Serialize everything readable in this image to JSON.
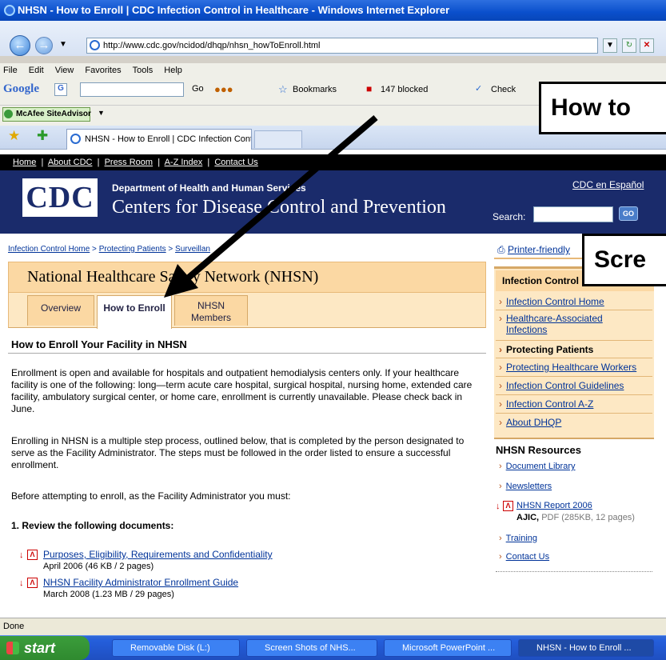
{
  "window": {
    "title": "NHSN - How to Enroll | CDC Infection Control in Healthcare - Windows Internet Explorer"
  },
  "browser": {
    "url": "http://www.cdc.gov/ncidod/dhqp/nhsn_howToEnroll.html",
    "menu": [
      "File",
      "Edit",
      "View",
      "Favorites",
      "Tools",
      "Help"
    ],
    "google_toolbar": {
      "logo": "Google",
      "go": "Go",
      "bookmarks": "Bookmarks",
      "blocked": "147 blocked",
      "check": "Check"
    },
    "mcafee": "McAfee SiteAdvisor",
    "tab_title": "NHSN - How to Enroll | CDC Infection Control in Healt..."
  },
  "site": {
    "topnav": [
      "Home",
      "About CDC",
      "Press Room",
      "A-Z Index",
      "Contact Us"
    ],
    "logo": "CDC",
    "department": "Department of Health and Human Services",
    "agency": "Centers for Disease Control and Prevention",
    "espanol": "CDC en Español",
    "search_label": "Search:",
    "go_label": "GO"
  },
  "breadcrumbs": {
    "items": [
      "Infection Control Home",
      "Protecting Patients",
      "Surveillan"
    ]
  },
  "page": {
    "title": "National Healthcare Safety Network (NHSN)",
    "tabs": [
      "Overview",
      "How to Enroll",
      "NHSN",
      "Members"
    ],
    "heading": "How to Enroll Your Facility in NHSN",
    "paragraphs": [
      "Enrollment is open and available for hospitals and outpatient hemodialysis centers only. If your healthcare facility is one of the following: long—term acute care hospital, surgical hospital, nursing home, extended care facility, ambulatory surgical center, or home care, enrollment is currently unavailable. Please check back in June.",
      "Enrolling in NHSN is a multiple step process, outlined below, that is completed by the person designated to serve as the Facility Administrator. The steps must be followed in the order listed to ensure a successful enrollment.",
      "Before attempting to enroll, as the Facility Administrator you must:"
    ],
    "step1": "1. Review the following documents:",
    "docs": [
      {
        "title": "Purposes, Eligibility, Requirements and Confidentiality",
        "meta": "April 2006 (46 KB / 2 pages)"
      },
      {
        "title": "NHSN Facility Administrator Enrollment Guide",
        "meta": "March 2008 (1.23 MB / 29 pages)"
      }
    ]
  },
  "sidebar": {
    "printer": "Printer-friendly",
    "box_title": "Infection Control",
    "items": [
      "Infection Control Home",
      "Healthcare-Associated",
      "Infections",
      "Protecting Patients",
      "Protecting Healthcare Workers",
      "Infection Control Guidelines",
      "Infection Control A-Z",
      "About DHQP"
    ],
    "resources_title": "NHSN Resources",
    "resources": [
      "Document Library",
      "Newsletters",
      "NHSN Report 2006",
      "Training",
      "Contact Us"
    ],
    "report_meta_bold": "AJIC,",
    "report_meta": "PDF (285KB, 12 pages)"
  },
  "callouts": {
    "how": "How to",
    "screen": "Scre"
  },
  "status": "Done",
  "taskbar": {
    "start": "start",
    "items": [
      "Removable Disk (L:)",
      "Screen Shots of NHS...",
      "Microsoft PowerPoint ...",
      "NHSN - How to Enroll ..."
    ]
  },
  "colors": {
    "cdc_blue": "#1a2b6b",
    "tab_orange": "#fbd8a3",
    "link": "#003399",
    "xp_blue": "#245edb"
  }
}
